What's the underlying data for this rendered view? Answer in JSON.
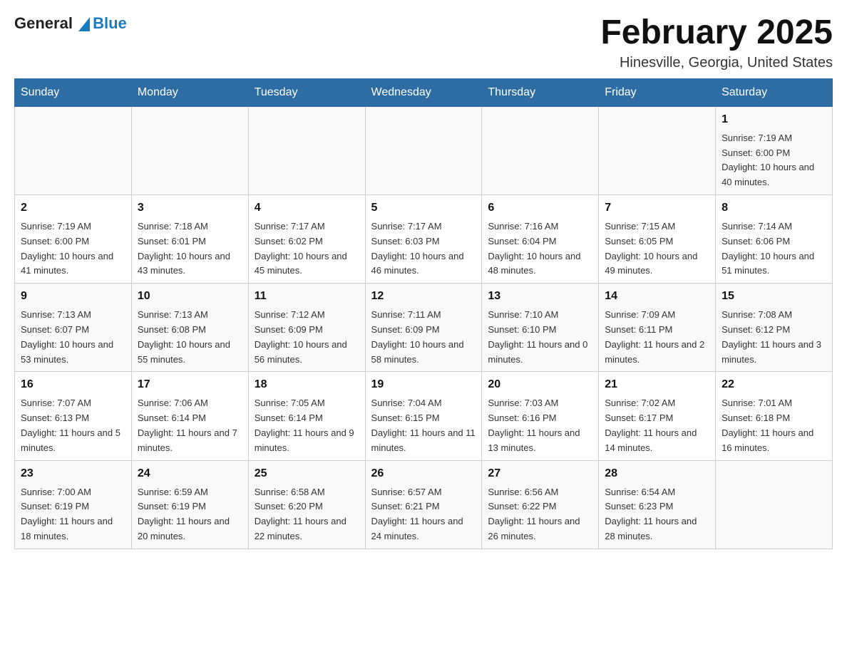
{
  "header": {
    "logo_general": "General",
    "logo_blue": "Blue",
    "title": "February 2025",
    "subtitle": "Hinesville, Georgia, United States"
  },
  "calendar": {
    "days_of_week": [
      "Sunday",
      "Monday",
      "Tuesday",
      "Wednesday",
      "Thursday",
      "Friday",
      "Saturday"
    ],
    "weeks": [
      [
        {
          "day": "",
          "info": ""
        },
        {
          "day": "",
          "info": ""
        },
        {
          "day": "",
          "info": ""
        },
        {
          "day": "",
          "info": ""
        },
        {
          "day": "",
          "info": ""
        },
        {
          "day": "",
          "info": ""
        },
        {
          "day": "1",
          "info": "Sunrise: 7:19 AM\nSunset: 6:00 PM\nDaylight: 10 hours and 40 minutes."
        }
      ],
      [
        {
          "day": "2",
          "info": "Sunrise: 7:19 AM\nSunset: 6:00 PM\nDaylight: 10 hours and 41 minutes."
        },
        {
          "day": "3",
          "info": "Sunrise: 7:18 AM\nSunset: 6:01 PM\nDaylight: 10 hours and 43 minutes."
        },
        {
          "day": "4",
          "info": "Sunrise: 7:17 AM\nSunset: 6:02 PM\nDaylight: 10 hours and 45 minutes."
        },
        {
          "day": "5",
          "info": "Sunrise: 7:17 AM\nSunset: 6:03 PM\nDaylight: 10 hours and 46 minutes."
        },
        {
          "day": "6",
          "info": "Sunrise: 7:16 AM\nSunset: 6:04 PM\nDaylight: 10 hours and 48 minutes."
        },
        {
          "day": "7",
          "info": "Sunrise: 7:15 AM\nSunset: 6:05 PM\nDaylight: 10 hours and 49 minutes."
        },
        {
          "day": "8",
          "info": "Sunrise: 7:14 AM\nSunset: 6:06 PM\nDaylight: 10 hours and 51 minutes."
        }
      ],
      [
        {
          "day": "9",
          "info": "Sunrise: 7:13 AM\nSunset: 6:07 PM\nDaylight: 10 hours and 53 minutes."
        },
        {
          "day": "10",
          "info": "Sunrise: 7:13 AM\nSunset: 6:08 PM\nDaylight: 10 hours and 55 minutes."
        },
        {
          "day": "11",
          "info": "Sunrise: 7:12 AM\nSunset: 6:09 PM\nDaylight: 10 hours and 56 minutes."
        },
        {
          "day": "12",
          "info": "Sunrise: 7:11 AM\nSunset: 6:09 PM\nDaylight: 10 hours and 58 minutes."
        },
        {
          "day": "13",
          "info": "Sunrise: 7:10 AM\nSunset: 6:10 PM\nDaylight: 11 hours and 0 minutes."
        },
        {
          "day": "14",
          "info": "Sunrise: 7:09 AM\nSunset: 6:11 PM\nDaylight: 11 hours and 2 minutes."
        },
        {
          "day": "15",
          "info": "Sunrise: 7:08 AM\nSunset: 6:12 PM\nDaylight: 11 hours and 3 minutes."
        }
      ],
      [
        {
          "day": "16",
          "info": "Sunrise: 7:07 AM\nSunset: 6:13 PM\nDaylight: 11 hours and 5 minutes."
        },
        {
          "day": "17",
          "info": "Sunrise: 7:06 AM\nSunset: 6:14 PM\nDaylight: 11 hours and 7 minutes."
        },
        {
          "day": "18",
          "info": "Sunrise: 7:05 AM\nSunset: 6:14 PM\nDaylight: 11 hours and 9 minutes."
        },
        {
          "day": "19",
          "info": "Sunrise: 7:04 AM\nSunset: 6:15 PM\nDaylight: 11 hours and 11 minutes."
        },
        {
          "day": "20",
          "info": "Sunrise: 7:03 AM\nSunset: 6:16 PM\nDaylight: 11 hours and 13 minutes."
        },
        {
          "day": "21",
          "info": "Sunrise: 7:02 AM\nSunset: 6:17 PM\nDaylight: 11 hours and 14 minutes."
        },
        {
          "day": "22",
          "info": "Sunrise: 7:01 AM\nSunset: 6:18 PM\nDaylight: 11 hours and 16 minutes."
        }
      ],
      [
        {
          "day": "23",
          "info": "Sunrise: 7:00 AM\nSunset: 6:19 PM\nDaylight: 11 hours and 18 minutes."
        },
        {
          "day": "24",
          "info": "Sunrise: 6:59 AM\nSunset: 6:19 PM\nDaylight: 11 hours and 20 minutes."
        },
        {
          "day": "25",
          "info": "Sunrise: 6:58 AM\nSunset: 6:20 PM\nDaylight: 11 hours and 22 minutes."
        },
        {
          "day": "26",
          "info": "Sunrise: 6:57 AM\nSunset: 6:21 PM\nDaylight: 11 hours and 24 minutes."
        },
        {
          "day": "27",
          "info": "Sunrise: 6:56 AM\nSunset: 6:22 PM\nDaylight: 11 hours and 26 minutes."
        },
        {
          "day": "28",
          "info": "Sunrise: 6:54 AM\nSunset: 6:23 PM\nDaylight: 11 hours and 28 minutes."
        },
        {
          "day": "",
          "info": ""
        }
      ]
    ]
  }
}
